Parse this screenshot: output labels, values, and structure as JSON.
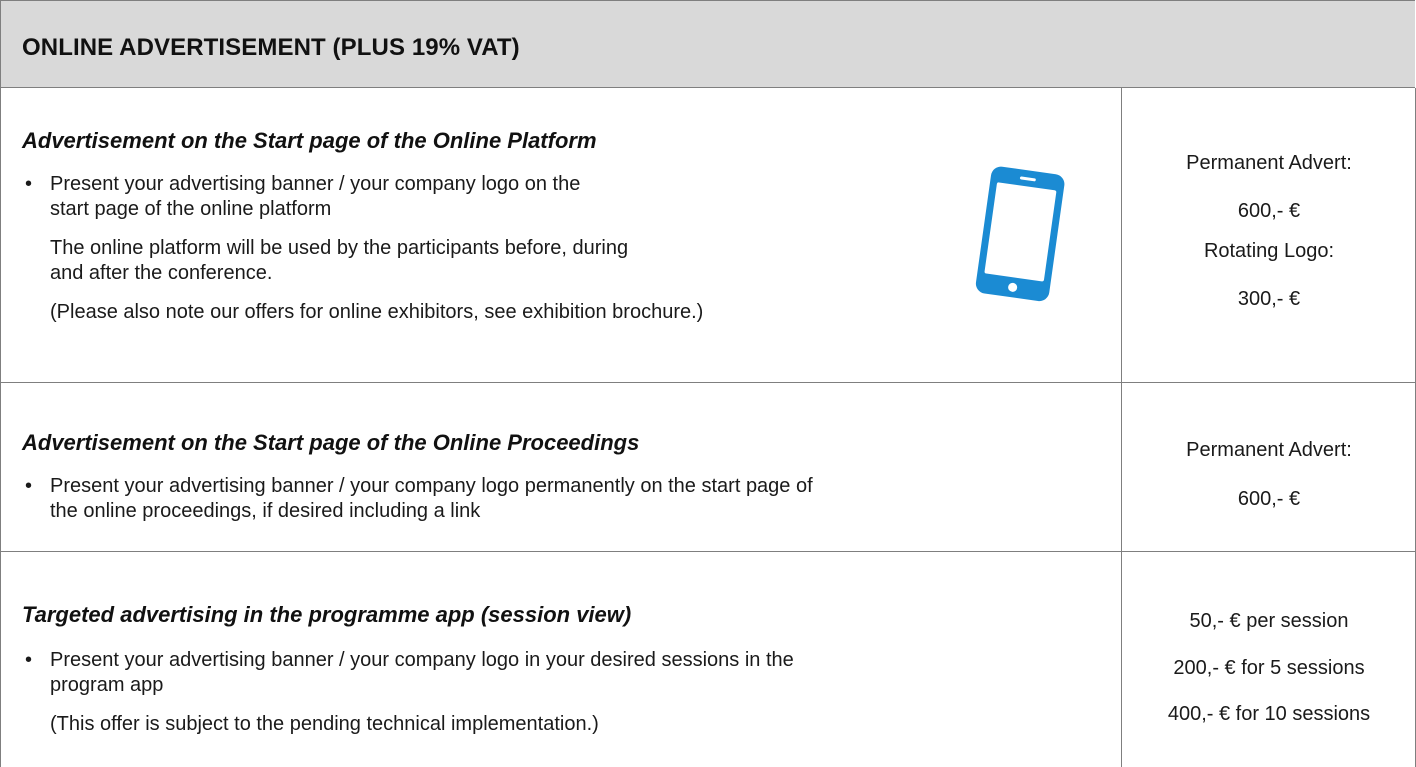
{
  "header": {
    "title": "ONLINE ADVERTISEMENT (PLUS 19% VAT)"
  },
  "sections": [
    {
      "title": "Advertisement on the Start page of the Online Platform",
      "bullet_lines": [
        "Present your advertising banner / your company logo on the",
        "start page of the online platform"
      ],
      "paragraph_lines": [
        "The online platform will be used by the participants before, during",
        "and after the conference."
      ],
      "note": "(Please also note our offers for online exhibitors, see exhibition brochure.)",
      "icon": "smartphone-icon",
      "icon_color": "#1b8bd3",
      "prices": [
        "Permanent Advert:",
        "600,- €",
        "Rotating Logo:",
        "300,- €"
      ]
    },
    {
      "title": "Advertisement on the Start page of the Online Proceedings",
      "bullet_lines": [
        "Present your advertising banner / your company logo permanently on the start page of",
        "the online proceedings, if desired including a link"
      ],
      "prices": [
        "Permanent Advert:",
        "600,- €"
      ]
    },
    {
      "title": "Targeted advertising in the programme app (session view)",
      "bullet_lines": [
        "Present your advertising banner / your company logo in your desired sessions in the",
        "program app"
      ],
      "note": "(This offer is subject to the pending technical implementation.)",
      "prices": [
        "50,- € per session",
        "200,- € for 5 sessions",
        "400,- € for 10 sessions"
      ]
    }
  ],
  "colors": {
    "header_background": "#d9d9d9",
    "border": "#7f7f7f",
    "icon_blue": "#1b8bd3"
  }
}
